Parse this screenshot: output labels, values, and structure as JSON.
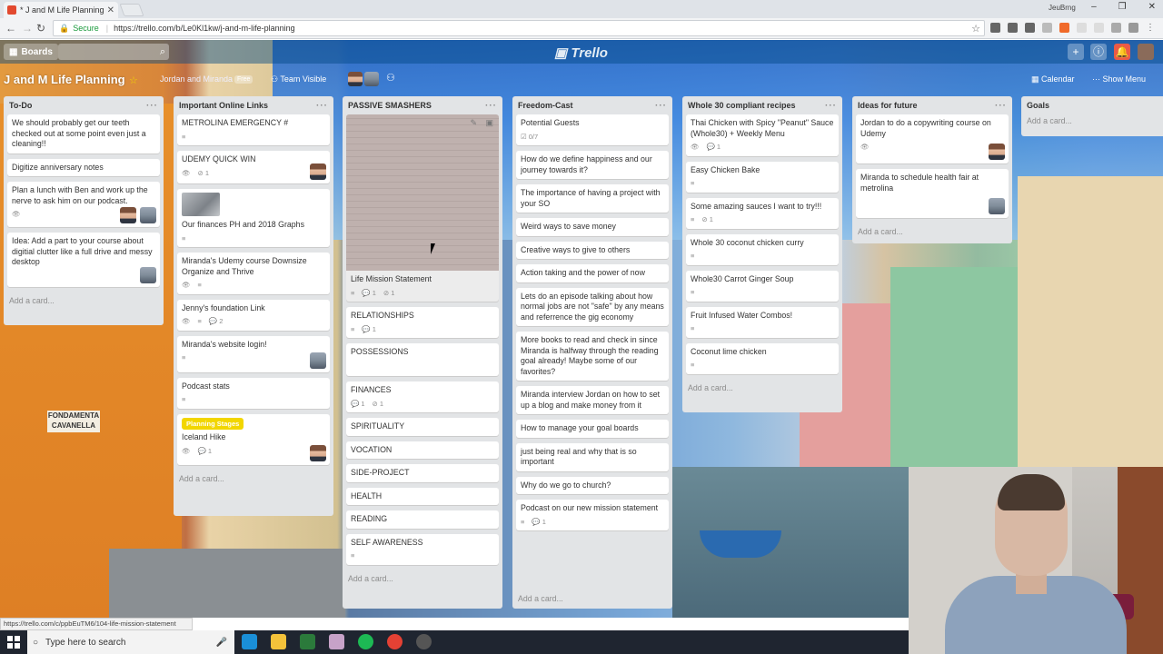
{
  "browser": {
    "tab_title": "* J and M Life Planning |",
    "user_name": "JeuBrng",
    "secure_label": "Secure",
    "url": "https://trello.com/b/Le0Kl1kw/j-and-m-life-planning"
  },
  "trello_header": {
    "boards_label": "Boards",
    "logo": "Trello"
  },
  "board": {
    "title": "J and M Life Planning",
    "team": "Jordan and Miranda",
    "plan": "Free",
    "visibility": "Team Visible",
    "calendar": "Calendar",
    "show_menu": "Show Menu"
  },
  "lists": [
    {
      "name": "To-Do",
      "add": "Add a card...",
      "cards": [
        {
          "text": "We should probably get our teeth checked out at some point even just a cleaning!!"
        },
        {
          "text": "Digitize anniversary notes"
        },
        {
          "text": "Plan a lunch with Ben and work up the nerve to ask him on our podcast."
        },
        {
          "text": "Idea: Add a part to your course about digitial clutter like a full drive and messy desktop"
        }
      ]
    },
    {
      "name": "Important Online Links",
      "add": "Add a card...",
      "cards": [
        {
          "text": "METROLINA EMERGENCY #"
        },
        {
          "text": "UDEMY QUICK WIN",
          "attach": "1"
        },
        {
          "text": "Our finances PH and 2018 Graphs"
        },
        {
          "text": "Miranda's Udemy course Downsize Organize and Thrive"
        },
        {
          "text": "Jenny's foundation Link",
          "comments": "2"
        },
        {
          "text": "Miranda's website login!"
        },
        {
          "text": "Podcast stats"
        },
        {
          "label": "Planning Stages",
          "text": "Iceland Hike",
          "comments": "1"
        }
      ]
    },
    {
      "name": "PASSIVE SMASHERS",
      "add": "Add a card...",
      "cards": [
        {
          "text": "Life Mission Statement",
          "comments": "1",
          "attach": "1"
        },
        {
          "text": "RELATIONSHIPS",
          "comments": "1"
        },
        {
          "text": "POSSESSIONS"
        },
        {
          "text": "FINANCES",
          "comments": "1",
          "attach": "1"
        },
        {
          "text": "SPIRITUALITY"
        },
        {
          "text": "VOCATION"
        },
        {
          "text": "SIDE-PROJECT"
        },
        {
          "text": "HEALTH"
        },
        {
          "text": "READING"
        },
        {
          "text": "SELF AWARENESS"
        }
      ]
    },
    {
      "name": "Freedom-Cast",
      "add": "Add a card...",
      "cards": [
        {
          "text": "Potential Guests",
          "checklist": "0/7"
        },
        {
          "text": "How do we define happiness and our journey towards it?"
        },
        {
          "text": "The importance of having a project with your SO"
        },
        {
          "text": "Weird ways to save money"
        },
        {
          "text": "Creative ways to give to others"
        },
        {
          "text": "Action taking and the power of now"
        },
        {
          "text": "Lets do an episode talking about how normal jobs are not \"safe\" by any means and referrence the gig economy"
        },
        {
          "text": "More books to read and check in since Miranda is halfway through the reading goal already! Maybe some of our favorites?"
        },
        {
          "text": "Miranda interview Jordan on how to set up a blog and make money from it"
        },
        {
          "text": "How to manage your goal boards"
        },
        {
          "text": "just being real and why that is so important"
        },
        {
          "text": "Why do we go to church?"
        },
        {
          "text": "Podcast on our new mission statement",
          "comments": "1"
        }
      ]
    },
    {
      "name": "Whole 30 compliant recipes",
      "add": "Add a card...",
      "cards": [
        {
          "text": "Thai Chicken with Spicy \"Peanut\" Sauce (Whole30) + Weekly Menu",
          "comments": "1"
        },
        {
          "text": "Easy Chicken Bake"
        },
        {
          "text": "Some amazing sauces I want to try!!!",
          "attach": "1"
        },
        {
          "text": "Whole 30 coconut chicken curry"
        },
        {
          "text": "Whole30 Carrot Ginger Soup"
        },
        {
          "text": "Fruit Infused Water Combos!"
        },
        {
          "text": "Coconut lime chicken"
        }
      ]
    },
    {
      "name": "Ideas for future",
      "add": "Add a card...",
      "cards": [
        {
          "text": "Jordan to do a copywriting course on Udemy"
        },
        {
          "text": "Miranda to schedule health fair at metrolina"
        }
      ]
    },
    {
      "name": "Goals",
      "add": "Add a card...",
      "cards": []
    }
  ],
  "status_url": "https://trello.com/c/ppbEuTM6/104-life-mission-statement",
  "taskbar": {
    "search_placeholder": "Type here to search"
  },
  "background_sign": "FONDAMENTA CAVANELLA"
}
